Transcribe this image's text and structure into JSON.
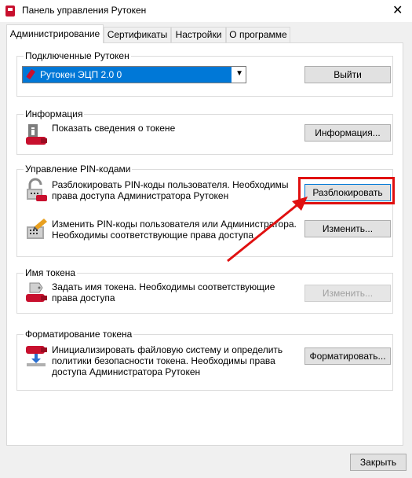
{
  "window": {
    "title": "Панель управления Рутокен",
    "close_glyph": "✕"
  },
  "tabs": [
    {
      "label": "Администрирование"
    },
    {
      "label": "Сертификаты"
    },
    {
      "label": "Настройки"
    },
    {
      "label": "О программе"
    }
  ],
  "connected": {
    "label": "Подключенные Рутокен",
    "selected_device": "Рутокен ЭЦП 2.0 0",
    "logout_button": "Выйти"
  },
  "info": {
    "label": "Информация",
    "text": "Показать сведения о токене",
    "button": "Информация..."
  },
  "pin": {
    "label": "Управление PIN-кодами",
    "unblock_text_1": "Разблокировать PIN-коды пользователя. Необходимы",
    "unblock_text_2": "права доступа Администратора Рутокен",
    "unblock_button": "Разблокировать",
    "change_text_1": "Изменить PIN-коды пользователя или Администратора.",
    "change_text_2": "Необходимы соответствующие права доступа",
    "change_button": "Изменить..."
  },
  "token_name": {
    "label": "Имя токена",
    "text_1": "Задать  имя токена.  Необходимы соответствующие",
    "text_2": "права доступа",
    "button": "Изменить..."
  },
  "format": {
    "label": "Форматирование токена",
    "text_1": "Инициализировать файловую систему и определить",
    "text_2": "политики безопасности токена. Необходимы права",
    "text_3": "доступа Администратора Рутокен",
    "button": "Форматировать..."
  },
  "footer": {
    "close_button": "Закрыть"
  },
  "colors": {
    "accent": "#0078d7",
    "highlight": "#e01010",
    "token_red": "#c8102e"
  }
}
